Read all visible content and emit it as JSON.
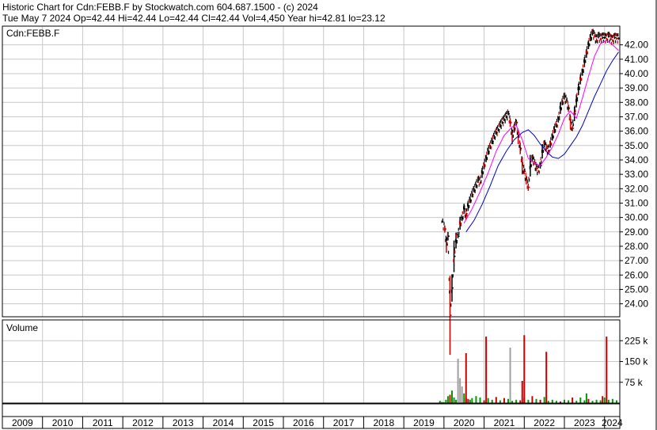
{
  "header": {
    "line1": "Historic Chart for Cdn:FEBB.F by Stockwatch.com 604.687.1500 - (c) 2024",
    "line2": "Tue May  7 2024   Op=42.44   Hi=42.44   Lo=42.44   Cl=42.44   Vol=4,450   Year hi=42.81   lo=23.12"
  },
  "colors": {
    "background": "#ffffff",
    "grid": "#c8c8c8",
    "axis": "#000000",
    "price_up": "#000000",
    "price_down": "#cc0000",
    "ma_fast": "#ff00ff",
    "ma_slow": "#0000cc",
    "vol_up": "#009900",
    "vol_down": "#cc0000",
    "vol_flat": "#a0a0a0"
  },
  "chart_data": [
    {
      "type": "line",
      "title": "Cdn:FEBB.F",
      "xlabel": "",
      "ylabel": "",
      "ylim": [
        23.1,
        43.3
      ],
      "y_ticks": [
        "24.00",
        "25.00",
        "26.00",
        "27.00",
        "28.00",
        "29.00",
        "30.00",
        "31.00",
        "32.00",
        "33.00",
        "34.00",
        "35.00",
        "36.00",
        "37.00",
        "38.00",
        "39.00",
        "40.00",
        "41.00",
        "42.00"
      ],
      "x_labels": [
        "2009",
        "2010",
        "2011",
        "2012",
        "2013",
        "2014",
        "2015",
        "2016",
        "2017",
        "2018",
        "2019",
        "2020",
        "2021",
        "2022",
        "2023",
        "2024"
      ],
      "grid": true,
      "series": [
        {
          "kind": "price",
          "x": [
            2019.95,
            2020.02,
            2020.06,
            2020.1,
            2020.15,
            2020.2,
            2020.25,
            2020.3,
            2020.35,
            2020.4,
            2020.45,
            2020.5,
            2020.55,
            2020.6,
            2020.65,
            2020.7,
            2020.75,
            2020.8,
            2020.85,
            2020.9,
            2020.95,
            2021.0,
            2021.05,
            2021.1,
            2021.15,
            2021.2,
            2021.25,
            2021.3,
            2021.35,
            2021.4,
            2021.45,
            2021.5,
            2021.55,
            2021.6,
            2021.65,
            2021.7,
            2021.75,
            2021.8,
            2021.85,
            2021.9,
            2021.95,
            2022.0,
            2022.05,
            2022.1,
            2022.15,
            2022.2,
            2022.25,
            2022.3,
            2022.35,
            2022.4,
            2022.45,
            2022.5,
            2022.55,
            2022.6,
            2022.65,
            2022.7,
            2022.75,
            2022.8,
            2022.85,
            2022.9,
            2022.95,
            2023.0,
            2023.05,
            2023.1,
            2023.15,
            2023.2,
            2023.25,
            2023.3,
            2023.35,
            2023.4,
            2023.45,
            2023.5,
            2023.55,
            2023.6,
            2023.65,
            2023.7,
            2023.75,
            2023.8,
            2023.85,
            2023.9,
            2023.95,
            2024.0,
            2024.05,
            2024.1,
            2024.15,
            2024.2,
            2024.25,
            2024.3,
            2024.35
          ],
          "y": [
            29.7,
            29.2,
            28.1,
            28.7,
            23.2,
            25.1,
            27.3,
            28.4,
            28.7,
            29.6,
            29.9,
            30.6,
            30.1,
            30.8,
            31.2,
            31.6,
            31.9,
            32.2,
            32.6,
            32.4,
            33.1,
            33.6,
            34.1,
            34.6,
            34.9,
            35.3,
            35.6,
            35.9,
            36.1,
            36.4,
            36.6,
            36.8,
            37.0,
            37.2,
            36.6,
            35.6,
            36.2,
            36.6,
            35.6,
            34.8,
            33.6,
            33.2,
            32.6,
            32.1,
            33.6,
            34.1,
            33.8,
            33.4,
            33.2,
            33.6,
            34.6,
            35.1,
            34.8,
            34.6,
            35.1,
            35.6,
            36.1,
            36.4,
            36.8,
            37.6,
            38.0,
            38.4,
            38.1,
            37.6,
            36.6,
            36.2,
            37.2,
            38.1,
            38.9,
            39.6,
            40.1,
            40.8,
            41.4,
            42.0,
            42.5,
            42.8,
            42.6,
            42.3,
            42.6,
            42.4,
            42.5,
            42.5,
            42.4,
            42.6,
            42.4,
            42.3,
            42.5,
            42.44,
            42.44
          ]
        },
        {
          "name": "",
          "kind": "ma_fast",
          "x": [
            2020.5,
            2020.7,
            2020.9,
            2021.1,
            2021.3,
            2021.5,
            2021.7,
            2021.8,
            2021.95,
            2022.1,
            2022.25,
            2022.4,
            2022.55,
            2022.7,
            2022.85,
            2023.0,
            2023.15,
            2023.3,
            2023.45,
            2023.6,
            2023.75,
            2023.9,
            2024.05,
            2024.2,
            2024.35
          ],
          "y": [
            29.6,
            30.6,
            31.8,
            33.1,
            34.6,
            35.7,
            36.3,
            36.4,
            35.4,
            34.1,
            33.8,
            33.6,
            34.2,
            34.9,
            35.8,
            36.9,
            37.4,
            36.9,
            38.3,
            39.8,
            41.2,
            42.1,
            42.3,
            42.0,
            41.6
          ]
        },
        {
          "name": "",
          "kind": "ma_slow",
          "x": [
            2020.55,
            2020.75,
            2020.95,
            2021.15,
            2021.35,
            2021.55,
            2021.75,
            2021.95,
            2022.1,
            2022.25,
            2022.4,
            2022.55,
            2022.7,
            2022.85,
            2023.0,
            2023.15,
            2023.3,
            2023.45,
            2023.6,
            2023.75,
            2023.9,
            2024.05,
            2024.2,
            2024.35
          ],
          "y": [
            29.0,
            29.8,
            30.9,
            32.2,
            33.6,
            34.6,
            35.4,
            35.9,
            36.1,
            35.7,
            35.1,
            34.6,
            34.2,
            34.1,
            34.4,
            35.0,
            35.6,
            36.4,
            37.4,
            38.4,
            39.3,
            40.2,
            40.9,
            41.5
          ]
        }
      ]
    },
    {
      "type": "bar",
      "title": "Volume",
      "xlabel": "",
      "ylabel": "",
      "ylim": [
        0,
        300000
      ],
      "y_ticks": [
        "75 k",
        "150 k",
        "225 k"
      ],
      "grid": true,
      "x": [
        2019.9,
        2019.95,
        2020.0,
        2020.05,
        2020.1,
        2020.15,
        2020.2,
        2020.25,
        2020.3,
        2020.35,
        2020.4,
        2020.45,
        2020.5,
        2020.55,
        2020.6,
        2020.65,
        2020.7,
        2020.8,
        2020.9,
        2021.0,
        2021.1,
        2021.2,
        2021.3,
        2021.4,
        2021.5,
        2021.6,
        2021.65,
        2021.7,
        2021.8,
        2021.9,
        2022.0,
        2022.1,
        2022.2,
        2022.3,
        2022.4,
        2022.5,
        2022.55,
        2022.6,
        2022.7,
        2022.8,
        2022.9,
        2023.0,
        2023.1,
        2023.2,
        2023.3,
        2023.4,
        2023.5,
        2023.6,
        2023.7,
        2023.8,
        2023.9,
        2023.95,
        2024.0,
        2024.1,
        2024.2,
        2024.3
      ],
      "values": [
        8000,
        4000,
        3000,
        12000,
        25000,
        30000,
        45000,
        20000,
        12000,
        160000,
        90000,
        60000,
        35000,
        20000,
        15000,
        12000,
        18000,
        25000,
        20000,
        10000,
        18000,
        12000,
        22000,
        10000,
        18000,
        15000,
        200000,
        8000,
        12000,
        10000,
        20000,
        12000,
        25000,
        15000,
        12000,
        22000,
        185000,
        8000,
        12000,
        8000,
        6000,
        12000,
        10000,
        20000,
        8000,
        20000,
        10000,
        15000,
        8000,
        12000,
        10000,
        25000,
        20000,
        12000,
        15000,
        10000
      ],
      "colors": [
        "up",
        "up",
        "up",
        "up",
        "up",
        "down",
        "up",
        "up",
        "up",
        "flat",
        "flat",
        "flat",
        "up",
        "up",
        "down",
        "up",
        "up",
        "up",
        "up",
        "down",
        "up",
        "up",
        "down",
        "up",
        "down",
        "up",
        "flat",
        "up",
        "up",
        "down",
        "down",
        "up",
        "down",
        "up",
        "down",
        "up",
        "down",
        "up",
        "up",
        "up",
        "down",
        "up",
        "up",
        "down",
        "up",
        "up",
        "up",
        "down",
        "up",
        "up",
        "up",
        "down",
        "up",
        "up",
        "up",
        "up"
      ]
    }
  ],
  "volume_bars_extra": [
    {
      "x": 2020.55,
      "value": 180000,
      "color": "down"
    },
    {
      "x": 2021.05,
      "value": 240000,
      "color": "down"
    },
    {
      "x": 2021.95,
      "value": 80000,
      "color": "down"
    },
    {
      "x": 2022.0,
      "value": 245000,
      "color": "down"
    },
    {
      "x": 2023.55,
      "value": 35000,
      "color": "up"
    },
    {
      "x": 2024.05,
      "value": 240000,
      "color": "down"
    }
  ]
}
